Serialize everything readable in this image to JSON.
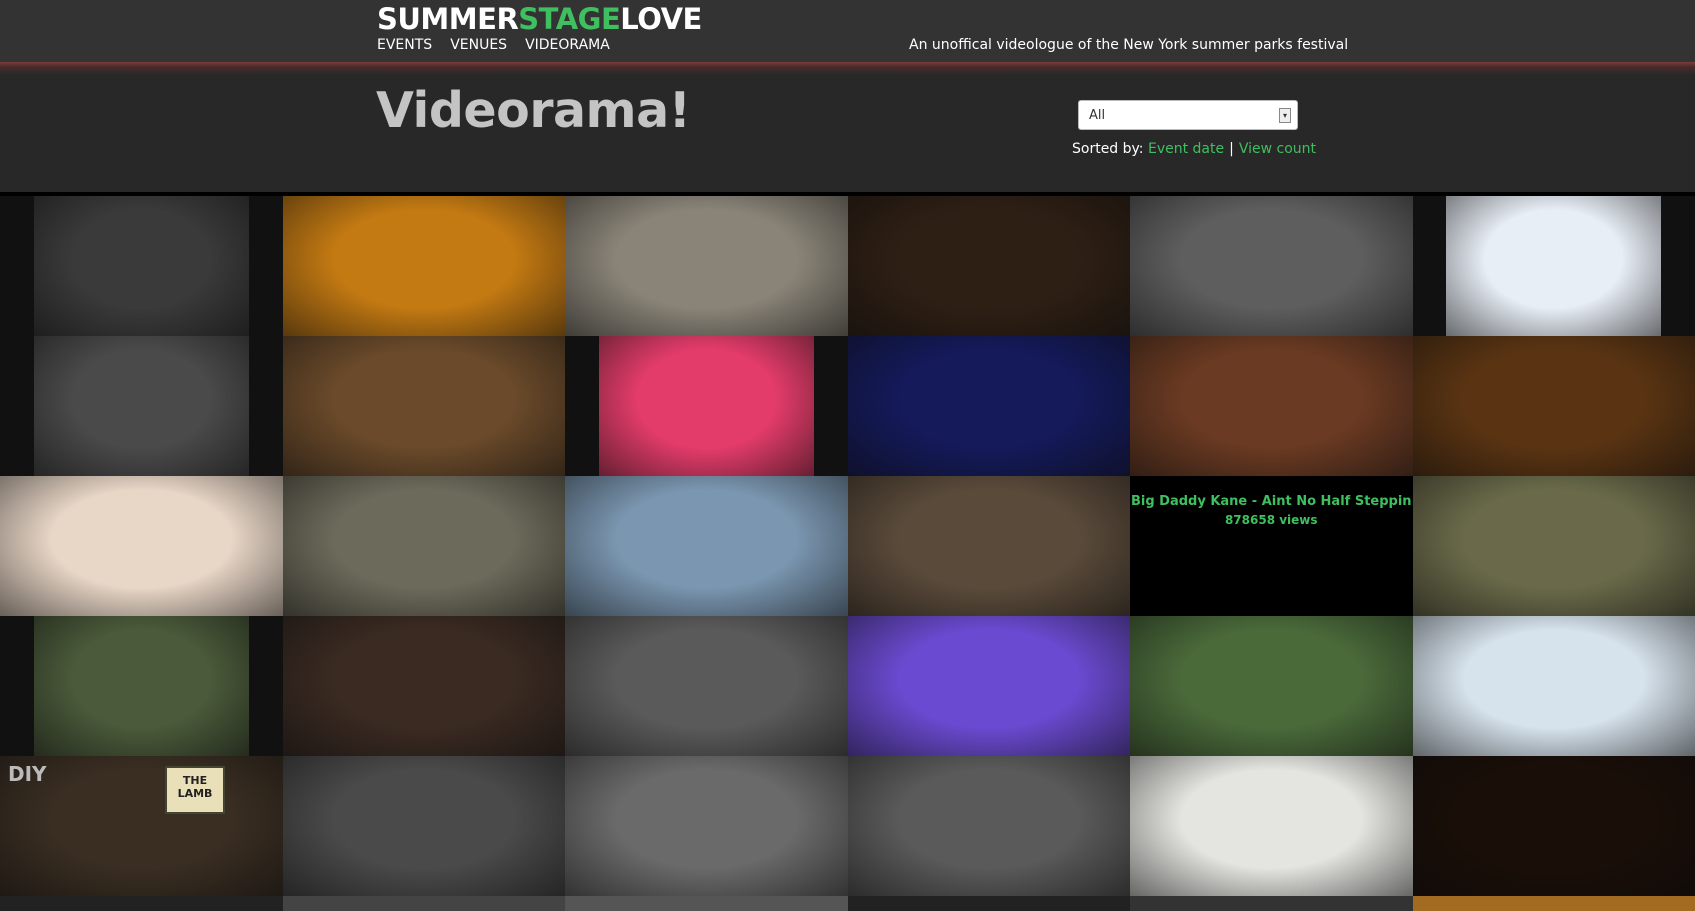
{
  "site": {
    "logo": {
      "part1": "SUMMER",
      "part2": "STAGE",
      "part3": "LOVE"
    },
    "nav": [
      "EVENTS",
      "VENUES",
      "VIDEORAMA"
    ],
    "tagline": "An unoffical videologue of the New York summer parks festival"
  },
  "page": {
    "title": "Videorama!",
    "filter_value": "All",
    "sort_label": "Sorted by:",
    "sort_options": [
      "Event date",
      "View count"
    ],
    "sort_separator": "|"
  },
  "videos": [
    {
      "id": "v1",
      "bg": "#3a3a3a"
    },
    {
      "id": "v2",
      "bg": "#c47a12"
    },
    {
      "id": "v3",
      "bg": "#8a8478"
    },
    {
      "id": "v4",
      "bg": "#2e1f14"
    },
    {
      "id": "v5",
      "bg": "#5e5e5e"
    },
    {
      "id": "v6",
      "bg": "#e8eef6"
    },
    {
      "id": "v7",
      "bg": "#4a4a4a"
    },
    {
      "id": "v8",
      "bg": "#6a4a2a"
    },
    {
      "id": "v9",
      "bg": "#e43c6a"
    },
    {
      "id": "v10",
      "bg": "#141a5a"
    },
    {
      "id": "v11",
      "bg": "#6a3a22"
    },
    {
      "id": "v12",
      "bg": "#5a3412"
    },
    {
      "id": "v13",
      "bg": "#e8d6c6"
    },
    {
      "id": "v14",
      "bg": "#6c6a5a"
    },
    {
      "id": "v15",
      "bg": "#7a96b0"
    },
    {
      "id": "v16",
      "bg": "#5a4a3a"
    },
    {
      "id": "v17",
      "bg": "#000000",
      "title": "Big Daddy Kane - Aint No Half Steppin",
      "views": "878658 views"
    },
    {
      "id": "v18",
      "bg": "#6a6a4a"
    },
    {
      "id": "v19",
      "bg": "#4a5a3a"
    },
    {
      "id": "v20",
      "bg": "#3a2a22"
    },
    {
      "id": "v21",
      "bg": "#5a5a5a"
    },
    {
      "id": "v22",
      "bg": "#6a4ad0"
    },
    {
      "id": "v23",
      "bg": "#4a6a3a"
    },
    {
      "id": "v24",
      "bg": "#d6e2ec"
    },
    {
      "id": "v25",
      "bg": "#3a2e22",
      "corner_text": "DIY",
      "sign_text": "THE LAMB"
    },
    {
      "id": "v26",
      "bg": "#4a4a4a"
    },
    {
      "id": "v27",
      "bg": "#6a6a6a"
    },
    {
      "id": "v28",
      "bg": "#5a5a5a"
    },
    {
      "id": "v29",
      "bg": "#e4e4e0"
    },
    {
      "id": "v30",
      "bg": "#1a0e08"
    }
  ],
  "colors": {
    "accent": "#3fbf5f",
    "bar": "#333333",
    "header": "#282828"
  }
}
